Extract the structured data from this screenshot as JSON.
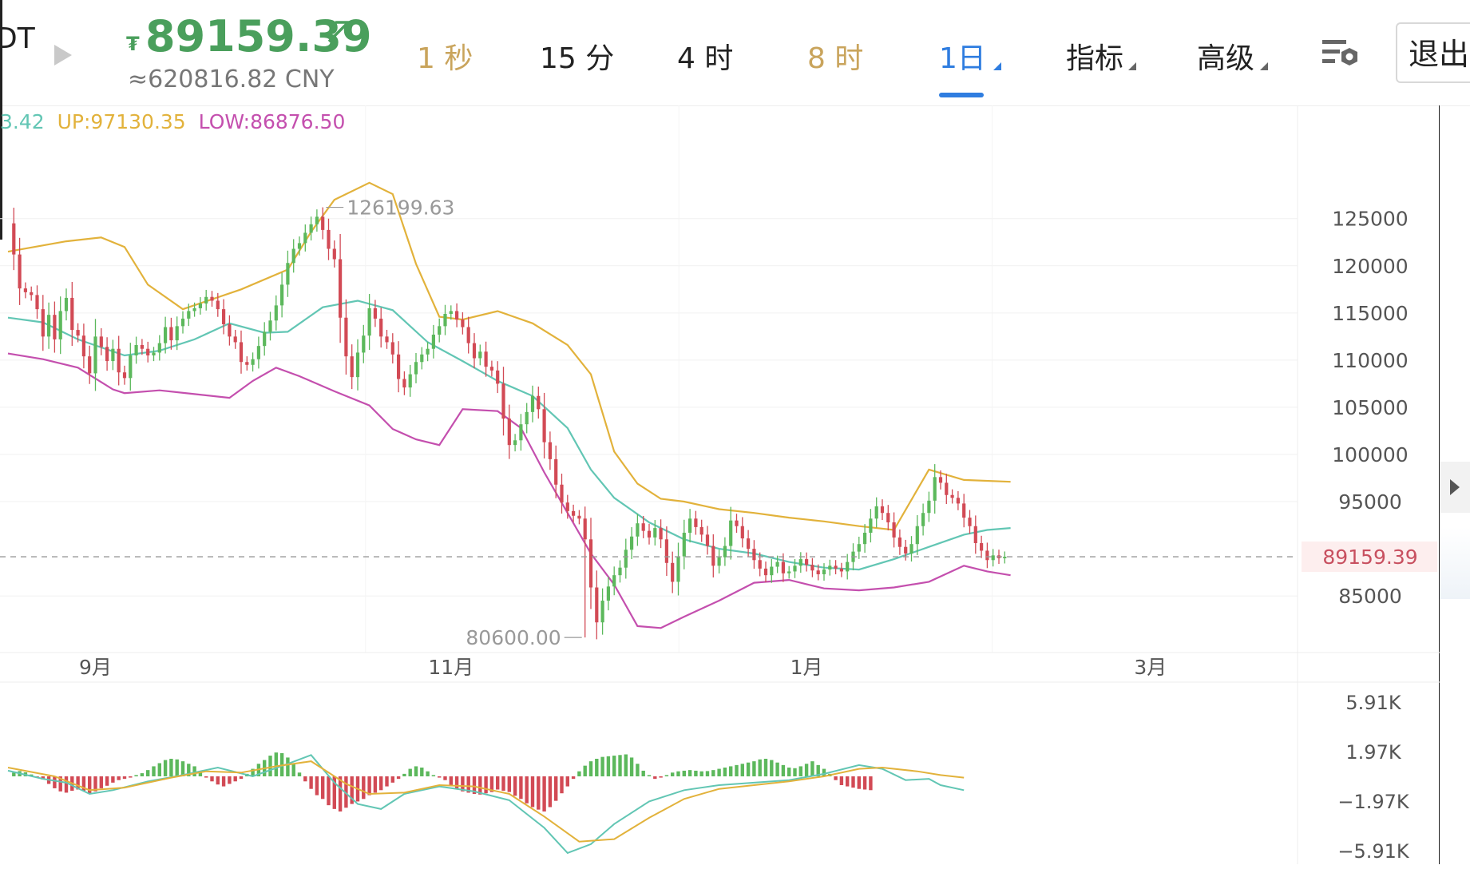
{
  "header": {
    "pair_label": "DT",
    "coin_symbol": "₮",
    "last_price": "89159.39",
    "cny_price": "≈620816.82 CNY",
    "tabs": [
      {
        "label": "1 秒",
        "style": "gold"
      },
      {
        "label": "15 分",
        "style": "dark"
      },
      {
        "label": "4 时",
        "style": "dark"
      },
      {
        "label": "8 时",
        "style": "gold"
      },
      {
        "label": "1日",
        "style": "active"
      },
      {
        "label": "指标",
        "style": "dark"
      },
      {
        "label": "高级",
        "style": "dark"
      }
    ],
    "exit_label": "退出"
  },
  "indicator_line": {
    "mid": "3.42",
    "up": "UP:97130.35",
    "low": "LOW:86876.50"
  },
  "colors": {
    "up": "#5cb85c",
    "down": "#d24a55",
    "boll_up": "#e2b23b",
    "boll_mid": "#62c6b4",
    "boll_low": "#c44fae",
    "price_tag": "#c85060",
    "accent": "#2f7de0"
  },
  "chart_data": {
    "type": "candlestick",
    "price_axis": {
      "ticks": [
        125000,
        120000,
        115000,
        110000,
        105000,
        100000,
        95000,
        85000
      ],
      "tick_labels": [
        "125000",
        "120000",
        "115000",
        "110000",
        "105000",
        "100000",
        "95000",
        "85000"
      ],
      "range": [
        79000,
        137000
      ],
      "current_price": 89159.39,
      "current_label": "89159.39"
    },
    "x_axis": {
      "labels": [
        {
          "text": "9月",
          "index": 15
        },
        {
          "text": "11月",
          "index": 76
        },
        {
          "text": "1月",
          "index": 137
        },
        {
          "text": "3月",
          "index": 196
        }
      ]
    },
    "annotations": [
      {
        "text": "126199.63",
        "index": 54,
        "value": 126199.63
      },
      {
        "text": "80600.00",
        "index": 99,
        "value": 80600
      }
    ],
    "closes": [
      124500,
      121200,
      117600,
      117200,
      116900,
      115400,
      112500,
      114800,
      112200,
      115200,
      116600,
      113200,
      112600,
      110400,
      108600,
      112500,
      111400,
      109900,
      111200,
      108700,
      108100,
      110500,
      111600,
      111200,
      110500,
      110800,
      111800,
      113500,
      112100,
      113600,
      114400,
      115200,
      115500,
      116000,
      116700,
      116300,
      115400,
      113800,
      112500,
      111900,
      109800,
      109500,
      110100,
      111500,
      113000,
      114200,
      115800,
      118000,
      120300,
      121800,
      122400,
      123500,
      124400,
      125200,
      123800,
      121800,
      120700,
      114500,
      110400,
      108200,
      110800,
      112600,
      115500,
      114400,
      112500,
      111900,
      110600,
      108000,
      107100,
      108500,
      109800,
      110600,
      111200,
      112700,
      113600,
      114900,
      115200,
      114300,
      113500,
      111800,
      110200,
      110900,
      109300,
      108900,
      107500,
      103800,
      101000,
      101500,
      103200,
      104500,
      106200,
      104800,
      101300,
      99500,
      96800,
      94900,
      94000,
      93500,
      93200,
      91000,
      85900,
      82200,
      84500,
      86000,
      87200,
      88000,
      89900,
      91300,
      92700,
      91900,
      91200,
      92200,
      91000,
      88500,
      86500,
      89200,
      91700,
      93200,
      92300,
      91500,
      90300,
      88200,
      89100,
      90300,
      93000,
      92400,
      91100,
      90000,
      88800,
      87900,
      87200,
      88100,
      88600,
      87400,
      87600,
      88200,
      88900,
      88300,
      87700,
      87300,
      87800,
      88200,
      87900,
      87600,
      88600,
      89700,
      90500,
      91700,
      93200,
      94500,
      93800,
      92800,
      91200,
      90200,
      89500,
      90500,
      92400,
      93800,
      95100,
      97600,
      97000,
      95700,
      95400,
      94800,
      93300,
      92400,
      90600,
      89800,
      88800,
      89300,
      89000,
      89159
    ],
    "boll_up_samples": [
      [
        0,
        121500
      ],
      [
        10,
        122600
      ],
      [
        16,
        123000
      ],
      [
        20,
        122000
      ],
      [
        24,
        118000
      ],
      [
        30,
        115400
      ],
      [
        40,
        117500
      ],
      [
        48,
        119600
      ],
      [
        52,
        123600
      ],
      [
        56,
        127000
      ],
      [
        62,
        128800
      ],
      [
        66,
        127600
      ],
      [
        70,
        120200
      ],
      [
        74,
        114600
      ],
      [
        78,
        114300
      ],
      [
        84,
        115200
      ],
      [
        90,
        113900
      ],
      [
        96,
        111600
      ],
      [
        100,
        108500
      ],
      [
        104,
        100300
      ],
      [
        108,
        96900
      ],
      [
        112,
        95300
      ],
      [
        116,
        95000
      ],
      [
        122,
        94200
      ],
      [
        128,
        93800
      ],
      [
        134,
        93300
      ],
      [
        140,
        92900
      ],
      [
        146,
        92400
      ],
      [
        152,
        92000
      ],
      [
        158,
        98400
      ],
      [
        164,
        97300
      ],
      [
        172,
        97100
      ]
    ],
    "boll_mid_samples": [
      [
        0,
        114500
      ],
      [
        6,
        114000
      ],
      [
        12,
        112200
      ],
      [
        20,
        110500
      ],
      [
        26,
        111000
      ],
      [
        32,
        112200
      ],
      [
        38,
        113900
      ],
      [
        44,
        112900
      ],
      [
        48,
        113000
      ],
      [
        54,
        115600
      ],
      [
        60,
        116300
      ],
      [
        66,
        115300
      ],
      [
        72,
        111900
      ],
      [
        78,
        109900
      ],
      [
        84,
        107800
      ],
      [
        90,
        106200
      ],
      [
        96,
        102800
      ],
      [
        100,
        98400
      ],
      [
        104,
        95400
      ],
      [
        110,
        92800
      ],
      [
        116,
        91000
      ],
      [
        122,
        90000
      ],
      [
        128,
        89500
      ],
      [
        134,
        88600
      ],
      [
        140,
        88000
      ],
      [
        146,
        87800
      ],
      [
        152,
        88900
      ],
      [
        158,
        90200
      ],
      [
        164,
        91500
      ],
      [
        168,
        92000
      ],
      [
        172,
        92200
      ]
    ],
    "boll_low_samples": [
      [
        0,
        110700
      ],
      [
        6,
        110100
      ],
      [
        12,
        109200
      ],
      [
        18,
        106900
      ],
      [
        20,
        106500
      ],
      [
        26,
        106800
      ],
      [
        32,
        106400
      ],
      [
        38,
        106000
      ],
      [
        42,
        107800
      ],
      [
        46,
        109200
      ],
      [
        50,
        108300
      ],
      [
        56,
        106700
      ],
      [
        62,
        105200
      ],
      [
        66,
        102700
      ],
      [
        70,
        101600
      ],
      [
        74,
        101000
      ],
      [
        78,
        104800
      ],
      [
        84,
        104600
      ],
      [
        88,
        102800
      ],
      [
        92,
        98100
      ],
      [
        96,
        93800
      ],
      [
        100,
        89500
      ],
      [
        104,
        86200
      ],
      [
        108,
        81800
      ],
      [
        112,
        81600
      ],
      [
        116,
        82800
      ],
      [
        122,
        84500
      ],
      [
        128,
        86400
      ],
      [
        134,
        86700
      ],
      [
        140,
        85800
      ],
      [
        146,
        85600
      ],
      [
        152,
        85900
      ],
      [
        158,
        86500
      ],
      [
        164,
        88200
      ],
      [
        168,
        87600
      ],
      [
        172,
        87200
      ]
    ],
    "macd_axis": {
      "ticks": [
        5910,
        1970,
        -1970,
        -5910
      ],
      "tick_labels": [
        "5.91K",
        "1.97K",
        "−1.97K",
        "−5.91K"
      ],
      "range": [
        -7000,
        7000
      ]
    },
    "macd_hist": [
      300,
      420,
      320,
      150,
      -50,
      -250,
      -600,
      -950,
      -1200,
      -1300,
      -1150,
      -1050,
      -1150,
      -1350,
      -1200,
      -950,
      -750,
      -500,
      -300,
      -200,
      -100,
      100,
      250,
      500,
      800,
      1050,
      1300,
      1400,
      1350,
      1200,
      1000,
      800,
      400,
      -100,
      -400,
      -650,
      -800,
      -600,
      -400,
      -200,
      200,
      600,
      1000,
      1300,
      1650,
      1900,
      1850,
      1500,
      1000,
      300,
      -400,
      -1000,
      -1500,
      -1800,
      -2300,
      -2600,
      -2800,
      -2500,
      -2200,
      -2000,
      -1800,
      -1500,
      -1300,
      -1100,
      -800,
      -500,
      -200,
      200,
      600,
      800,
      700,
      400,
      100,
      -100,
      -300,
      -700,
      -1000,
      -1200,
      -1300,
      -1400,
      -1450,
      -1350,
      -1250,
      -1050,
      -1150,
      -1250,
      -1550,
      -1800,
      -2150,
      -2450,
      -2650,
      -2800,
      -2450,
      -1950,
      -1350,
      -800,
      -200,
      400,
      850,
      1200,
      1400,
      1550,
      1600,
      1650,
      1700,
      1750,
      1500,
      1000,
      450,
      100,
      -200,
      -100,
      100,
      300,
      400,
      450,
      500,
      450,
      400,
      420,
      500,
      600,
      700,
      800,
      900,
      1000,
      1100,
      1200,
      1350,
      1400,
      1300,
      1100,
      900,
      700,
      650,
      800,
      1000,
      1200,
      900,
      600,
      200,
      -300,
      -700,
      -800,
      -900,
      -1000,
      -1050,
      -1100
    ],
    "macd_dif_samples": [
      [
        0,
        450
      ],
      [
        6,
        -200
      ],
      [
        10,
        -500
      ],
      [
        14,
        -1400
      ],
      [
        18,
        -1100
      ],
      [
        24,
        -400
      ],
      [
        30,
        100
      ],
      [
        36,
        700
      ],
      [
        42,
        0
      ],
      [
        48,
        1000
      ],
      [
        52,
        1700
      ],
      [
        56,
        -500
      ],
      [
        60,
        -2200
      ],
      [
        64,
        -2600
      ],
      [
        68,
        -1400
      ],
      [
        74,
        -800
      ],
      [
        80,
        -1200
      ],
      [
        86,
        -1900
      ],
      [
        92,
        -4100
      ],
      [
        96,
        -6100
      ],
      [
        100,
        -5400
      ],
      [
        104,
        -3800
      ],
      [
        110,
        -2000
      ],
      [
        116,
        -1100
      ],
      [
        122,
        -700
      ],
      [
        128,
        -500
      ],
      [
        134,
        -300
      ],
      [
        140,
        200
      ],
      [
        146,
        900
      ],
      [
        150,
        600
      ],
      [
        154,
        -300
      ],
      [
        158,
        -200
      ],
      [
        160,
        -700
      ],
      [
        164,
        -1100
      ]
    ],
    "macd_dea_samples": [
      [
        0,
        700
      ],
      [
        8,
        0
      ],
      [
        14,
        -1100
      ],
      [
        20,
        -900
      ],
      [
        28,
        -100
      ],
      [
        34,
        400
      ],
      [
        40,
        300
      ],
      [
        46,
        800
      ],
      [
        52,
        1200
      ],
      [
        58,
        -600
      ],
      [
        62,
        -1400
      ],
      [
        68,
        -1300
      ],
      [
        74,
        -700
      ],
      [
        80,
        -800
      ],
      [
        86,
        -1400
      ],
      [
        92,
        -3200
      ],
      [
        98,
        -5200
      ],
      [
        104,
        -5000
      ],
      [
        110,
        -3300
      ],
      [
        116,
        -1800
      ],
      [
        122,
        -1000
      ],
      [
        128,
        -700
      ],
      [
        134,
        -400
      ],
      [
        140,
        0
      ],
      [
        146,
        600
      ],
      [
        150,
        700
      ],
      [
        156,
        400
      ],
      [
        160,
        100
      ],
      [
        164,
        -100
      ]
    ]
  }
}
